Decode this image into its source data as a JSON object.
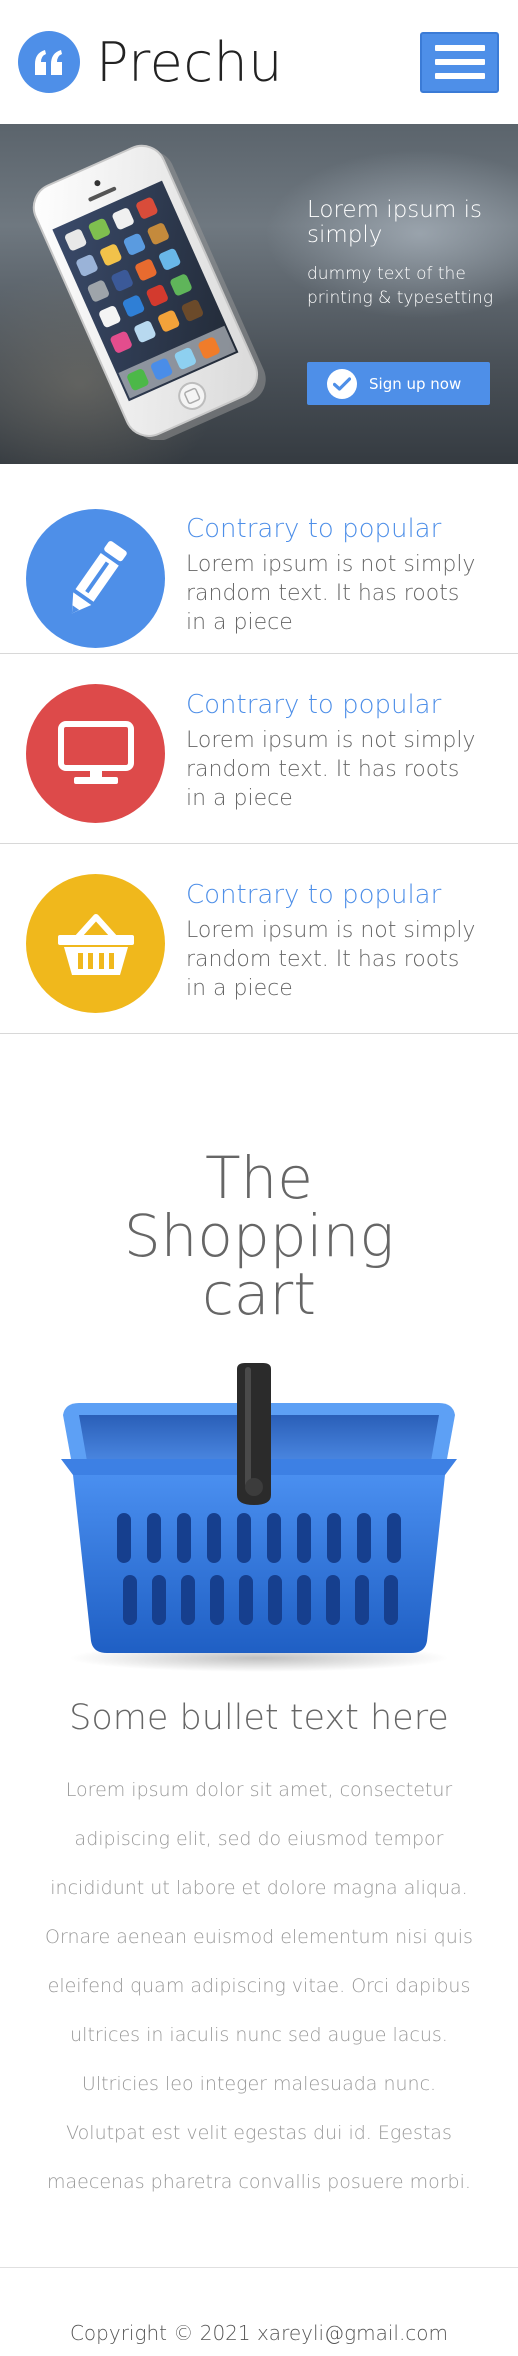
{
  "brand": {
    "name": "Prechu",
    "logo_icon": "quote-icon",
    "accent_color": "#4e8fe8"
  },
  "header": {
    "menu_icon": "hamburger-menu-icon"
  },
  "hero": {
    "title": "Lorem ipsum is simply",
    "subtitle": "dummy text of the printing & typesetting",
    "signup_label": "Sign up now",
    "image": "iphone-image"
  },
  "features": [
    {
      "title": "Contrary to popular",
      "description": "Lorem ipsum is not simply random text. It has roots in a piece",
      "icon": "pencil-icon",
      "color": "#4e8fe8"
    },
    {
      "title": "Contrary to popular",
      "description": "Lorem ipsum is not simply random text. It has roots in a piece",
      "icon": "monitor-icon",
      "color": "#dd4a4a"
    },
    {
      "title": "Contrary to popular",
      "description": "Lorem ipsum is not simply random text. It has roots in a piece",
      "icon": "basket-icon",
      "color": "#f0b81c"
    }
  ],
  "shopping": {
    "title": "The Shopping cart",
    "image": "shopping-basket-image",
    "subtitle": "Some bullet text here",
    "body": "Lorem ipsum dolor sit amet, consectetur adipiscing elit, sed do eiusmod tempor incididunt ut labore et dolore magna aliqua. Ornare aenean euismod elementum nisi quis eleifend quam adipiscing vitae. Orci dapibus ultrices in iaculis nunc sed augue lacus. Ultricies leo integer malesuada nunc. Volutpat est velit egestas dui id. Egestas maecenas pharetra convallis posuere morbi."
  },
  "footer": {
    "copyright": "Copyright © 2021 xareyli@gmail.com"
  }
}
